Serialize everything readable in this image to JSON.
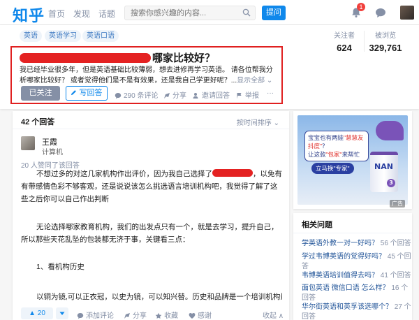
{
  "nav": {
    "logo": "知乎",
    "links": [
      "首页",
      "发现",
      "话题"
    ],
    "search_placeholder": "搜索你感兴趣的内容...",
    "ask_label": "提问",
    "notification_count": "1"
  },
  "question": {
    "tags": [
      "英语",
      "英语学习",
      "英语口语"
    ],
    "stats": [
      {
        "label": "关注者",
        "value": "624"
      },
      {
        "label": "被浏览",
        "value": "329,761"
      }
    ],
    "title_visible": "哪家比较好？",
    "detail": "我已经毕业很多年，但是英语基础比较薄弱，想去进修再学习英语。 请各位帮我分析哪家比较好？ 或者觉得他们是不是有效果，还是我自己学更好呢？...",
    "show_all": "显示全部",
    "follow_label": "已关注",
    "write_label": "写回答",
    "comments": "290 条评论",
    "share": "分享",
    "invite": "邀请回答",
    "report": "举报",
    "more": "···"
  },
  "answers": {
    "count": "42 个回答",
    "sort": "按时间排序",
    "author": {
      "name": "王霞",
      "title": "计算机"
    },
    "upvoters": "20 人赞同了该回答",
    "p1_a": "不想过多的对这几家机构作出评价，因为我自己选择了",
    "p1_b": "，以免有有带感情色彩不够客观，还是说说该怎么挑选语言培训机构吧，我觉得了解了这些之后你可以自己作出判断",
    "p2": "无论选择哪家教育机构，我们的出发点只有一个，就是去学习，提升自己，所以那些天花乱坠的包装都无济于事，关键看三点：",
    "p3": "1、看机构历史",
    "p4": "以铜为镜,可以正衣冠，以史为镜，可以知兴替。历史和品牌是一个培训机构最好的背书",
    "vote": "▲ 20",
    "add_comment": "添加评论",
    "share": "分享",
    "collect": "收藏",
    "thanks": "感谢",
    "fold": "收起 ∧"
  },
  "ad": {
    "bubble_line1": "宝宝也有两娃",
    "bubble_quote": "\"慧慧友抖度\"",
    "bubble_line2": "？",
    "bubble_line3": "让这款",
    "bubble_brand": "\"包家\"",
    "bubble_line4": "来帮忙",
    "cta": "立马换\"专家\"",
    "product": "NAN",
    "stage": "3",
    "label": "广告"
  },
  "related": {
    "title": "相关问题",
    "items": [
      {
        "q": "学英语外教一对一好吗？",
        "count": "56 个回答"
      },
      {
        "q": "学过韦博英语的觉得好吗？",
        "count": "45 个回答"
      },
      {
        "q": "韦博英语培训值得去吗？",
        "count": "41 个回答"
      },
      {
        "q": "面包英语 微信口语 怎么样？",
        "count": "16 个回答"
      },
      {
        "q": "华尔街英语和英孚该选哪个？",
        "count": "27 个回答"
      }
    ]
  },
  "colors": {
    "brand": "#0f88eb",
    "annotation_box": "#e02020",
    "redaction": "#e42222"
  }
}
